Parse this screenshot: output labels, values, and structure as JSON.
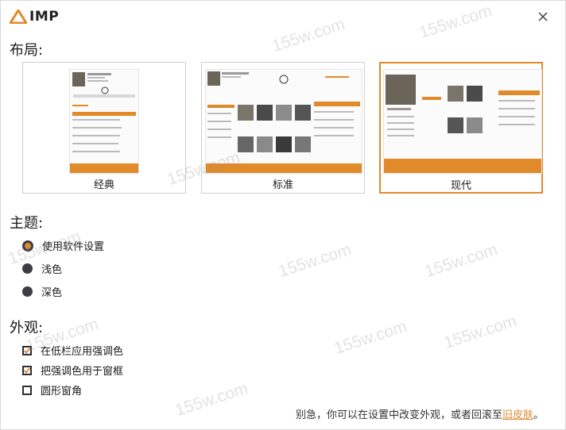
{
  "app": {
    "logo_text": "IMP"
  },
  "sections": {
    "layout_title": "布局:",
    "theme_title": "主题:",
    "appearance_title": "外观:"
  },
  "layouts": [
    {
      "label": "经典",
      "selected": false
    },
    {
      "label": "标准",
      "selected": false
    },
    {
      "label": "现代",
      "selected": true
    }
  ],
  "themes": [
    {
      "label": "使用软件设置",
      "checked": true
    },
    {
      "label": "浅色",
      "checked": false
    },
    {
      "label": "深色",
      "checked": false
    }
  ],
  "appearance": [
    {
      "label": "在低栏应用强调色",
      "checked": true
    },
    {
      "label": "把强调色用于窗框",
      "checked": true
    },
    {
      "label": "圆形窗角",
      "checked": false
    }
  ],
  "footer": {
    "text": "别急，你可以在设置中改变外观，或者回滚至",
    "link": "旧皮肤",
    "suffix": "。"
  },
  "watermark": "155w.com",
  "colors": {
    "accent": "#e08a2a",
    "dark": "#3c3c44"
  }
}
